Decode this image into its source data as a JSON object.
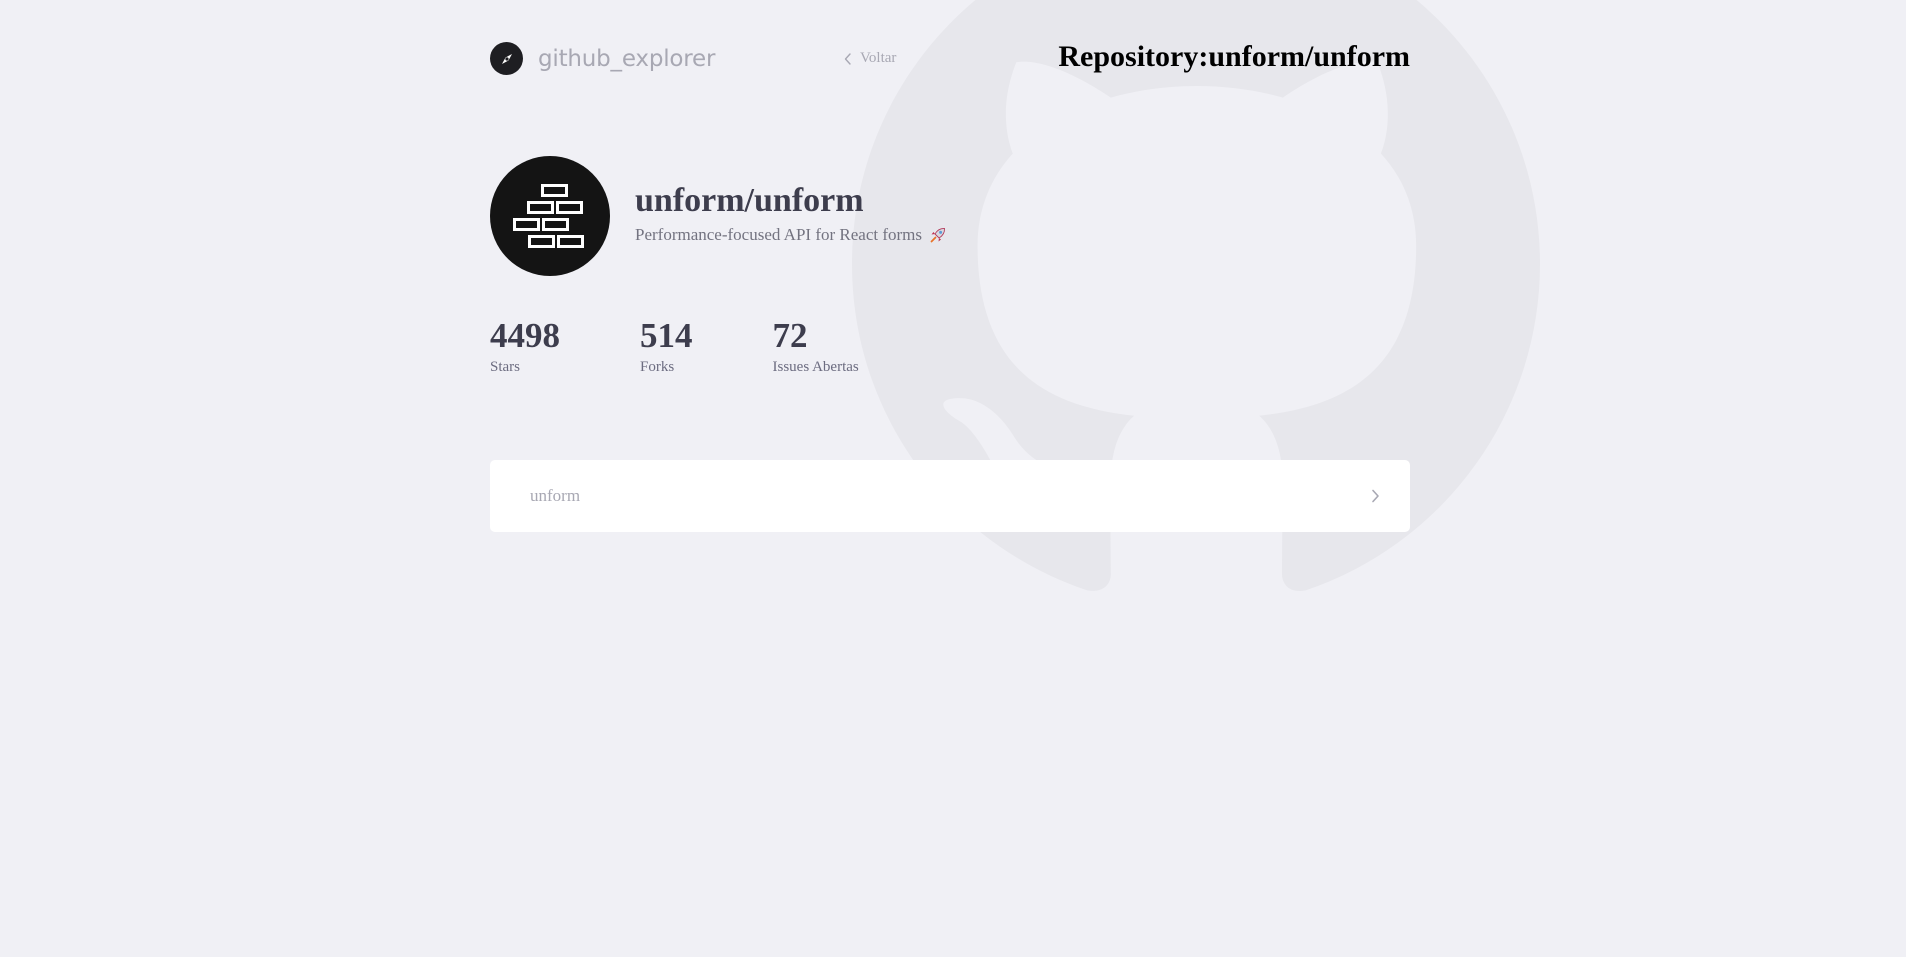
{
  "header": {
    "brand": "github_explorer",
    "back_label": "Voltar",
    "title": "Repository:unform/unform"
  },
  "repository": {
    "full_name": "unform/unform",
    "description": "Performance-focused API for React forms",
    "description_emoji": "rocket-icon"
  },
  "stats": [
    {
      "value": "4498",
      "label": "Stars"
    },
    {
      "value": "514",
      "label": "Forks"
    },
    {
      "value": "72",
      "label": "Issues Abertas"
    }
  ],
  "issues": [
    {
      "title": "unform"
    }
  ],
  "colors": {
    "background": "#f0f0f5",
    "brand_text": "#a8a8b3",
    "heading": "#3d3d4d",
    "muted": "#737380",
    "card": "#ffffff",
    "avatar": "#141414"
  }
}
